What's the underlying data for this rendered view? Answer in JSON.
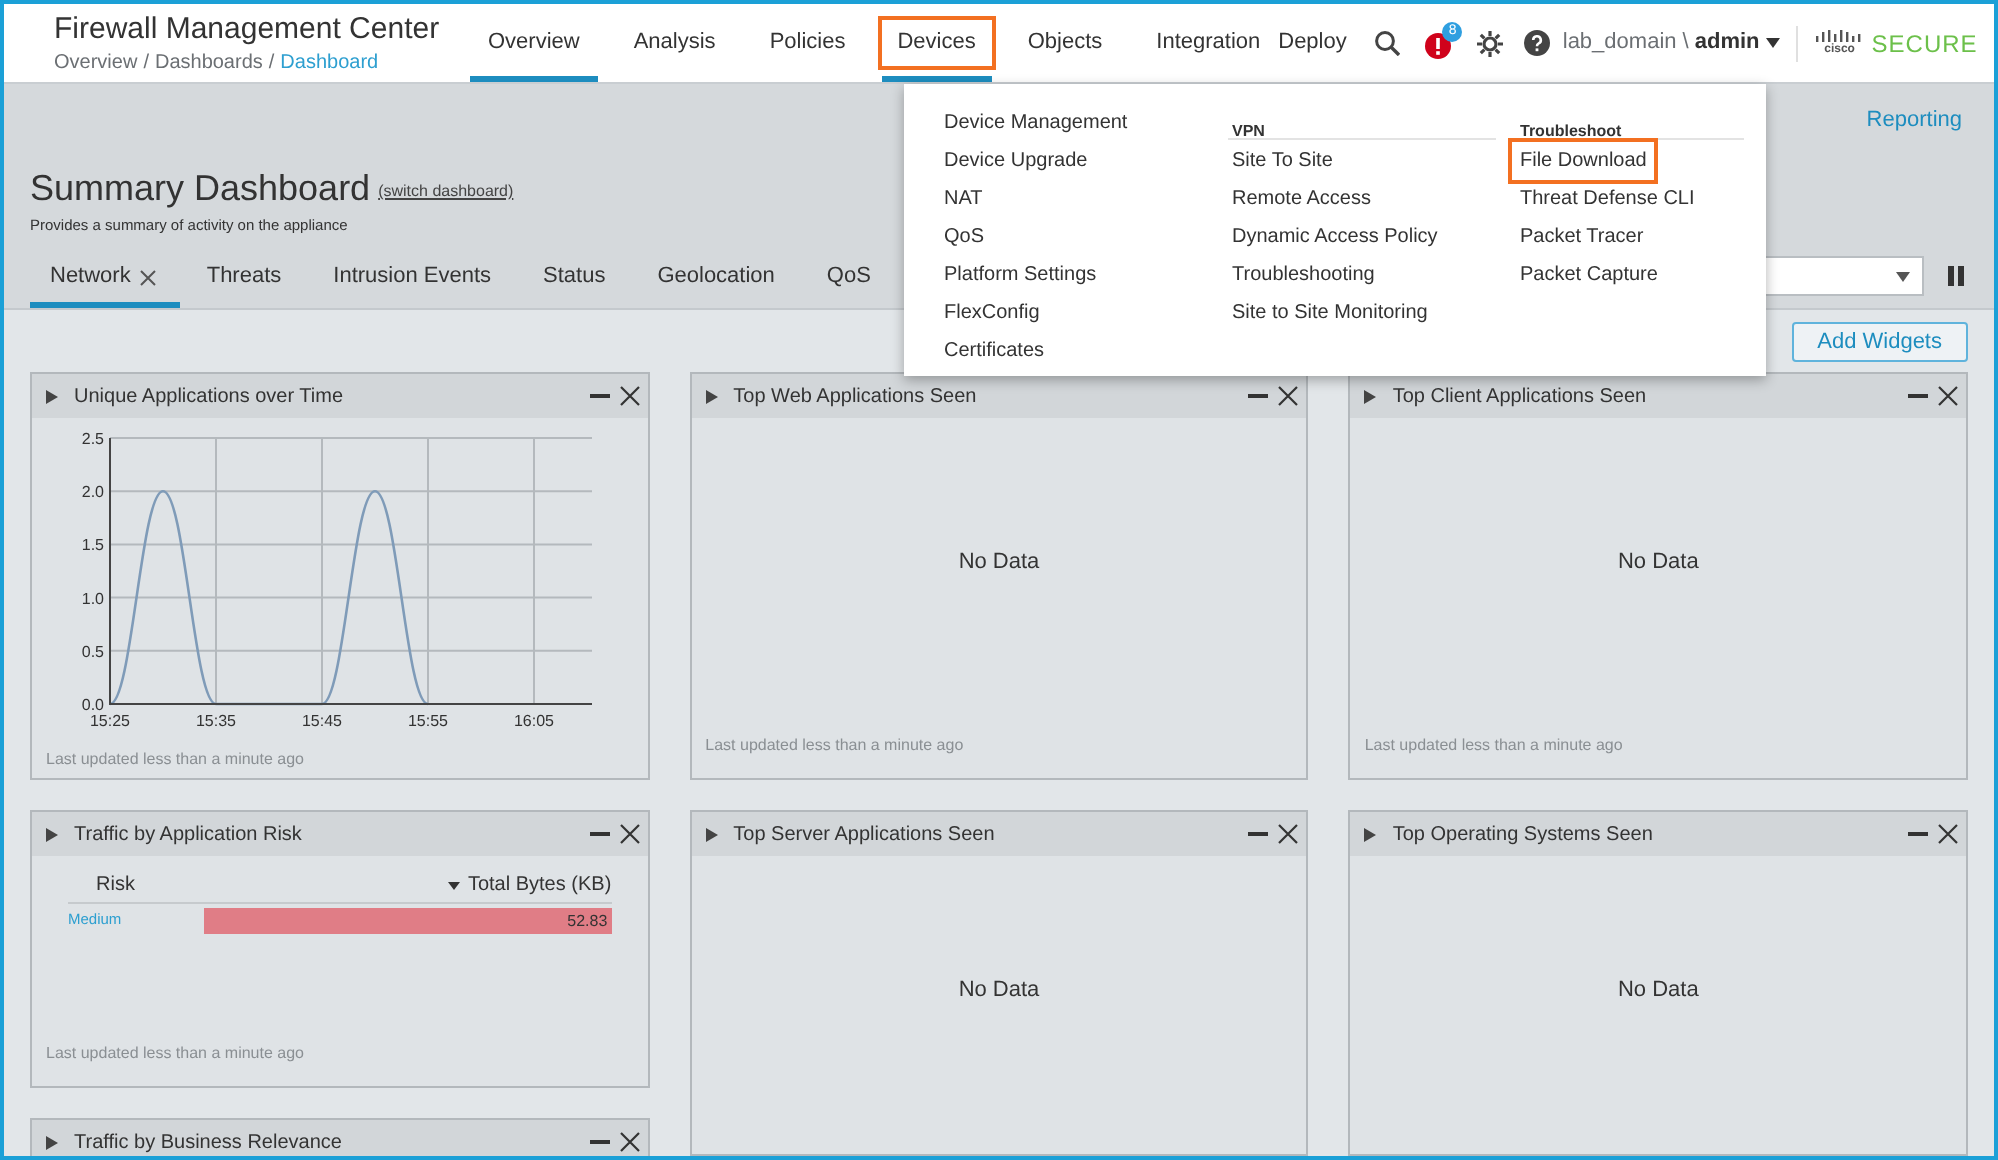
{
  "header": {
    "app_title": "Firewall Management Center",
    "breadcrumb": [
      {
        "label": "Overview",
        "current": false,
        "separator": "/"
      },
      {
        "label": "Dashboards",
        "current": false,
        "separator": "/"
      },
      {
        "label": "Dashboard",
        "current": true
      }
    ],
    "nav": [
      {
        "label": "Overview",
        "selected": true,
        "highlighted": false
      },
      {
        "label": "Analysis",
        "selected": false,
        "highlighted": false
      },
      {
        "label": "Policies",
        "selected": false,
        "highlighted": false
      },
      {
        "label": "Devices",
        "selected": true,
        "highlighted": true
      },
      {
        "label": "Objects",
        "selected": false,
        "highlighted": false
      },
      {
        "label": "Integration",
        "selected": false,
        "highlighted": false
      }
    ],
    "deploy": "Deploy",
    "alert_count": "8",
    "domain": "lab_domain \\",
    "user": "admin",
    "brand_small": "cisco",
    "brand": "SECURE"
  },
  "devices_menu": {
    "columns": [
      {
        "items": [
          {
            "label": "Device Management",
            "highlighted": false
          },
          {
            "label": "Device Upgrade",
            "highlighted": false
          },
          {
            "label": "NAT",
            "highlighted": false
          },
          {
            "label": "QoS",
            "highlighted": false
          },
          {
            "label": "Platform Settings",
            "highlighted": false
          },
          {
            "label": "FlexConfig",
            "highlighted": false
          },
          {
            "label": "Certificates",
            "highlighted": false
          }
        ]
      },
      {
        "heading": "VPN",
        "items": [
          {
            "label": "Site To Site",
            "highlighted": false
          },
          {
            "label": "Remote Access",
            "highlighted": false
          },
          {
            "label": "Dynamic Access Policy",
            "highlighted": false
          },
          {
            "label": "Troubleshooting",
            "highlighted": false
          },
          {
            "label": "Site to Site Monitoring",
            "highlighted": false
          }
        ]
      },
      {
        "heading": "Troubleshoot",
        "items": [
          {
            "label": "File Download",
            "highlighted": true
          },
          {
            "label": "Threat Defense CLI",
            "highlighted": false
          },
          {
            "label": "Packet Tracer",
            "highlighted": false
          },
          {
            "label": "Packet Capture",
            "highlighted": false
          }
        ]
      }
    ]
  },
  "page": {
    "reporting_link": "Reporting",
    "title": "Summary Dashboard",
    "switch_link": "(switch dashboard)",
    "subtitle": "Provides a summary of activity on the appliance",
    "tabs": [
      {
        "label": "Network",
        "selected": true,
        "closable": true
      },
      {
        "label": "Threats",
        "selected": false,
        "closable": false
      },
      {
        "label": "Intrusion Events",
        "selected": false,
        "closable": false
      },
      {
        "label": "Status",
        "selected": false,
        "closable": false
      },
      {
        "label": "Geolocation",
        "selected": false,
        "closable": false
      },
      {
        "label": "QoS",
        "selected": false,
        "closable": false
      }
    ],
    "add_widgets": "Add Widgets"
  },
  "widget_columns": [
    [
      {
        "title": "Unique Applications over Time",
        "kind": "chart",
        "footer": "Last updated less than a minute ago",
        "chart_data": {
          "type": "line",
          "grid": true,
          "categories": [
            "15:25",
            null,
            "15:35",
            null,
            "15:45",
            null,
            "15:55",
            null,
            "16:05"
          ],
          "series": [
            {
              "color": "#7f9bb8",
              "values": [
                0,
                2,
                0,
                0,
                0,
                2,
                0,
                null,
                null
              ]
            }
          ],
          "ylim": [
            0,
            2.5
          ],
          "yticks": [
            {
              "value": 0,
              "label": "0.0"
            },
            {
              "value": 0.5,
              "label": "0.5"
            },
            {
              "value": 1,
              "label": "1.0"
            },
            {
              "value": 1.5,
              "label": "1.5"
            },
            {
              "value": 2,
              "label": "2.0"
            },
            {
              "value": 2.5,
              "label": "2.5"
            }
          ]
        }
      },
      {
        "title": "Traffic by Application Risk",
        "kind": "risk_table",
        "footer": "Last updated less than a minute ago",
        "columns": [
          "Risk",
          "Total Bytes (KB)"
        ],
        "rows": [
          {
            "risk": "Medium",
            "value": "52.83"
          }
        ]
      },
      {
        "title": "Traffic by Business Relevance",
        "kind": "collapsed_view"
      }
    ],
    [
      {
        "title": "Top Web Applications Seen",
        "kind": "no_data",
        "message": "No Data",
        "footer": "Last updated less than a minute ago"
      },
      {
        "title": "Top Server Applications Seen",
        "kind": "no_data",
        "message": "No Data"
      }
    ],
    [
      {
        "title": "Top Client Applications Seen",
        "kind": "no_data",
        "message": "No Data",
        "footer": "Last updated less than a minute ago"
      },
      {
        "title": "Top Operating Systems Seen",
        "kind": "no_data",
        "message": "No Data"
      }
    ]
  ]
}
